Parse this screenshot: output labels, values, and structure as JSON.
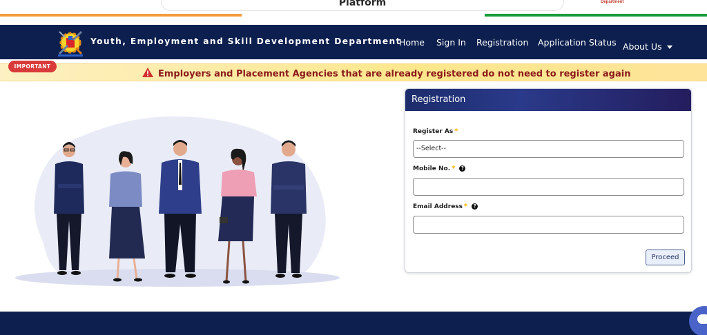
{
  "top_bar": {
    "card_title": "Platform",
    "right_text": "Department"
  },
  "header": {
    "department_title": "Youth, Employment and Skill Development Department"
  },
  "nav": {
    "home": "Home",
    "sign_in": "Sign In",
    "registration": "Registration",
    "application_status": "Application Status",
    "about_us": "About Us"
  },
  "banner": {
    "badge": "IMPORTANT",
    "message": "Employers and Placement Agencies that are already registered do not need to register again"
  },
  "registration_form": {
    "title": "Registration",
    "register_as_label": "Register As",
    "register_as_value": "--Select--",
    "mobile_label": "Mobile No.",
    "mobile_value": "",
    "email_label": "Email Address",
    "email_value": "",
    "required_mark": "*",
    "help_mark": "?",
    "proceed_label": "Proceed"
  },
  "colors": {
    "navbar": "#0c1f4e",
    "banner_text": "#8b1a1a",
    "badge": "#d93a3a",
    "required": "#f5b400",
    "saffron": "#f39a3a",
    "green": "#169c3c"
  },
  "icons": {
    "logo": "department-emblem",
    "warning": "warning-triangle-icon",
    "help": "question-circle-icon",
    "dropdown": "caret-down-icon",
    "chat": "chat-bubble-icon"
  }
}
